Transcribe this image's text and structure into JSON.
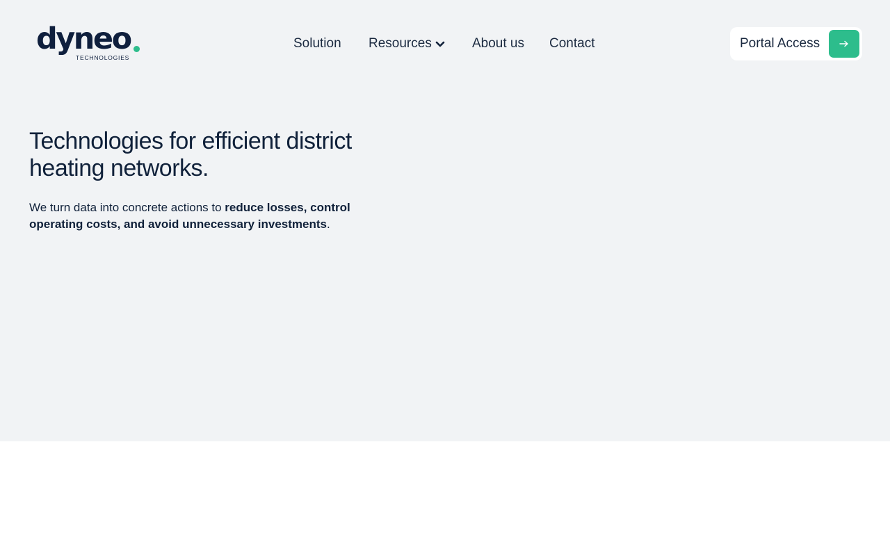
{
  "brand": {
    "name": "dyneo",
    "tagline": "TECHNOLOGIES",
    "colors": {
      "navy": "#0f1f3d",
      "accent": "#2dbd8c",
      "hero_bg": "#f1f3f5"
    }
  },
  "nav": {
    "items": [
      {
        "label": "Solution"
      },
      {
        "label": "Resources",
        "icon": "chevron-down-icon"
      },
      {
        "label": "About us"
      },
      {
        "label": "Contact"
      }
    ]
  },
  "portal": {
    "label": "Portal Access",
    "icon": "arrow-right-icon"
  },
  "hero": {
    "headline": "Technologies for efficient district heating networks.",
    "intro": "We turn data into concrete actions to ",
    "intro_bold": "reduce losses, control operating costs, and avoid unnecessary investments",
    "intro_end": "."
  }
}
